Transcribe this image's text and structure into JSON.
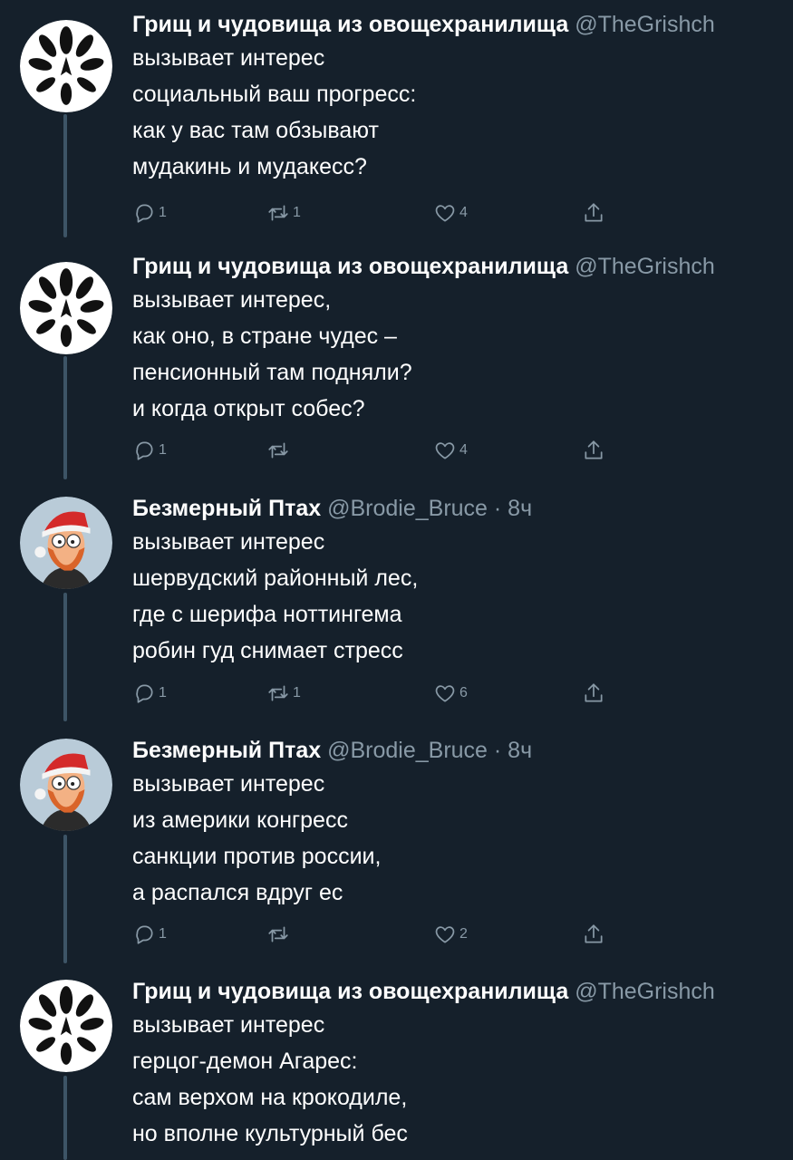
{
  "tweets": [
    {
      "author": "Грищ и чудовища из овощехранилища",
      "handle": "@TheGrishch",
      "time": "",
      "avatar": "seed-pod-icon",
      "lines": [
        "вызывает интерес",
        "социальный ваш прогресс:",
        "как у вас там обзывают",
        "мудакинь и мудакесс?"
      ],
      "replies": "1",
      "retweets": "1",
      "likes": "4"
    },
    {
      "author": "Грищ и чудовища из овощехранилища",
      "handle": "@TheGrishch",
      "time": "",
      "avatar": "seed-pod-icon",
      "lines": [
        "вызывает интерес,",
        "как оно, в стране чудес –",
        "пенсионный там подняли?",
        "и когда открыт собес?"
      ],
      "replies": "1",
      "retweets": "",
      "likes": "4"
    },
    {
      "author": "Безмерный Птах",
      "handle": "@Brodie_Bruce",
      "time": "· 8ч",
      "avatar": "santa-cartoon-avatar",
      "lines": [
        "вызывает интерес",
        "шервудский районный лес,",
        "где с шерифа ноттингема",
        "робин гуд снимает стресс"
      ],
      "replies": "1",
      "retweets": "1",
      "likes": "6"
    },
    {
      "author": "Безмерный Птах",
      "handle": "@Brodie_Bruce",
      "time": "· 8ч",
      "avatar": "santa-cartoon-avatar",
      "lines": [
        "вызывает интерес",
        "из америки конгресс",
        "санкции против россии,",
        "а распался вдруг ес"
      ],
      "replies": "1",
      "retweets": "",
      "likes": "2"
    },
    {
      "author": "Грищ и чудовища из овощехранилища",
      "handle": "@TheGrishch",
      "time": "",
      "avatar": "seed-pod-icon",
      "lines": [
        "вызывает интерес",
        "герцог-демон Агарес:",
        "сам верхом на крокодиле,",
        "но вполне культурный бес"
      ]
    }
  ],
  "colors": {
    "background": "#15202b",
    "muted": "#8899a6",
    "thread": "#3d5466"
  }
}
